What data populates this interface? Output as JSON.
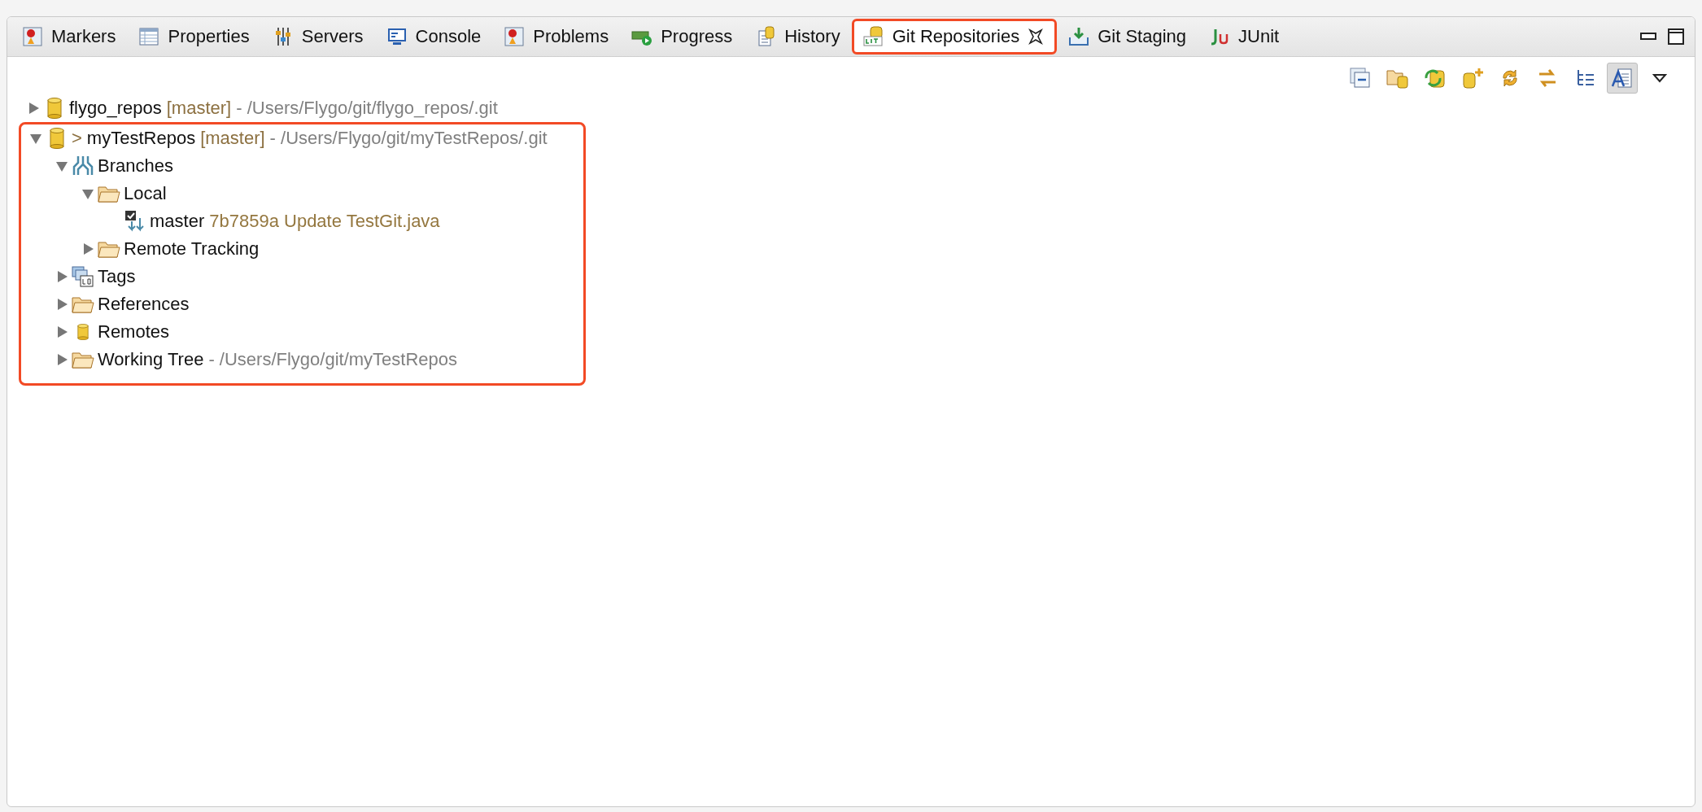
{
  "tabs": [
    {
      "label": "Markers",
      "kind": "markers",
      "selected": false,
      "highlighted": false
    },
    {
      "label": "Properties",
      "kind": "properties",
      "selected": false,
      "highlighted": false
    },
    {
      "label": "Servers",
      "kind": "servers",
      "selected": false,
      "highlighted": false
    },
    {
      "label": "Console",
      "kind": "console",
      "selected": false,
      "highlighted": false
    },
    {
      "label": "Problems",
      "kind": "markers",
      "selected": false,
      "highlighted": false
    },
    {
      "label": "Progress",
      "kind": "progress",
      "selected": false,
      "highlighted": false
    },
    {
      "label": "History",
      "kind": "history",
      "selected": false,
      "highlighted": false
    },
    {
      "label": "Git Repositories",
      "kind": "git",
      "selected": true,
      "highlighted": true
    },
    {
      "label": "Git Staging",
      "kind": "staging",
      "selected": false,
      "highlighted": false
    },
    {
      "label": "JUnit",
      "kind": "junit",
      "selected": false,
      "highlighted": false
    }
  ],
  "toolbar": [
    {
      "kind": "collapse",
      "pressed": false
    },
    {
      "kind": "add",
      "pressed": false
    },
    {
      "kind": "clone",
      "pressed": false
    },
    {
      "kind": "create",
      "pressed": false
    },
    {
      "kind": "refresh",
      "pressed": false
    },
    {
      "kind": "link",
      "pressed": false
    },
    {
      "kind": "layout",
      "pressed": false
    },
    {
      "kind": "details",
      "pressed": true
    },
    {
      "kind": "menu",
      "pressed": false
    }
  ],
  "tree": [
    {
      "kind": "repo",
      "label": "flygo_repos",
      "expanded": false,
      "highlighted": false,
      "suffix": [
        {
          "kind": "branch",
          "text": "[master]"
        },
        {
          "kind": "path",
          "text": "- /Users/Flygo/git/flygo_repos/.git"
        }
      ]
    },
    {
      "kind": "repo",
      "label": "myTestRepos",
      "expanded": true,
      "highlighted": true,
      "prefix": ">",
      "suffix": [
        {
          "kind": "branch",
          "text": "[master]"
        },
        {
          "kind": "path",
          "text": "- /Users/Flygo/git/myTestRepos/.git"
        }
      ],
      "children": [
        {
          "kind": "branches",
          "label": "Branches",
          "expanded": true,
          "children": [
            {
              "kind": "folder",
              "label": "Local",
              "expanded": true,
              "children": [
                {
                  "kind": "branch",
                  "label": "master",
                  "suffix": [
                    {
                      "kind": "commit",
                      "text": "7b7859a Update TestGit.java"
                    }
                  ]
                }
              ]
            },
            {
              "kind": "folder",
              "label": "Remote Tracking",
              "expanded": false
            }
          ]
        },
        {
          "kind": "tags",
          "label": "Tags",
          "expanded": false
        },
        {
          "kind": "folder",
          "label": "References",
          "expanded": false
        },
        {
          "kind": "remotes",
          "label": "Remotes",
          "expanded": false
        },
        {
          "kind": "folder",
          "label": "Working Tree",
          "expanded": false,
          "suffix": [
            {
              "kind": "path",
              "text": "- /Users/Flygo/git/myTestRepos"
            }
          ]
        }
      ]
    }
  ]
}
